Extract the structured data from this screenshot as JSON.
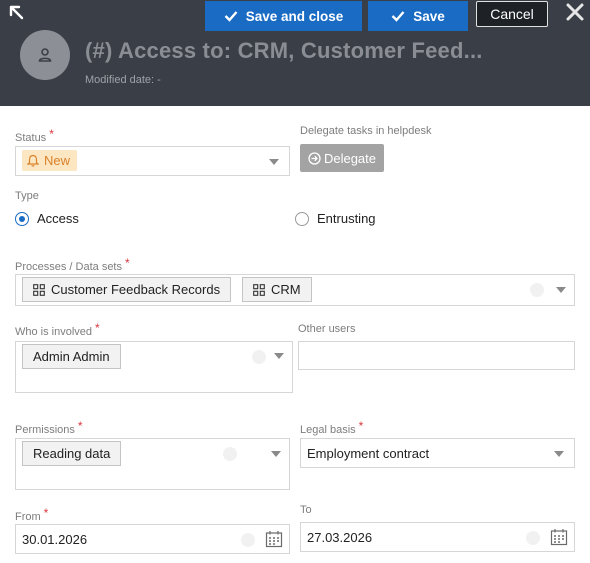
{
  "toolbar": {
    "save_and_close_label": "Save and close",
    "save_label": "Save",
    "cancel_label": "Cancel",
    "primary_color": "#1a6bc4"
  },
  "header": {
    "title": "(#) Access to: CRM, Customer Feed...",
    "modified": "Modified date: -",
    "avatar_icon": "user-icon",
    "background": "#3a3f47"
  },
  "form": {
    "status": {
      "label": "Status",
      "value": "New",
      "icon": "bell-icon"
    },
    "delegate": {
      "label": "Delegate tasks in helpdesk",
      "button_label": "Delegate",
      "icon": "arrow-circle-right-icon"
    },
    "type": {
      "label": "Type",
      "options": [
        {
          "label": "Access",
          "selected": true
        },
        {
          "label": "Entrusting",
          "selected": false
        }
      ]
    },
    "processes": {
      "label": "Processes / Data sets",
      "items": [
        "Customer Feedback Records",
        "CRM"
      ]
    },
    "who_involved": {
      "label": "Who is involved",
      "items": [
        "Admin Admin"
      ]
    },
    "other_users": {
      "label": "Other users",
      "value": ""
    },
    "permissions": {
      "label": "Permissions",
      "items": [
        "Reading data"
      ]
    },
    "legal_basis": {
      "label": "Legal basis",
      "value": "Employment contract"
    },
    "from": {
      "label": "From",
      "value": "30.01.2026"
    },
    "to": {
      "label": "To",
      "value": "27.03.2026"
    }
  }
}
